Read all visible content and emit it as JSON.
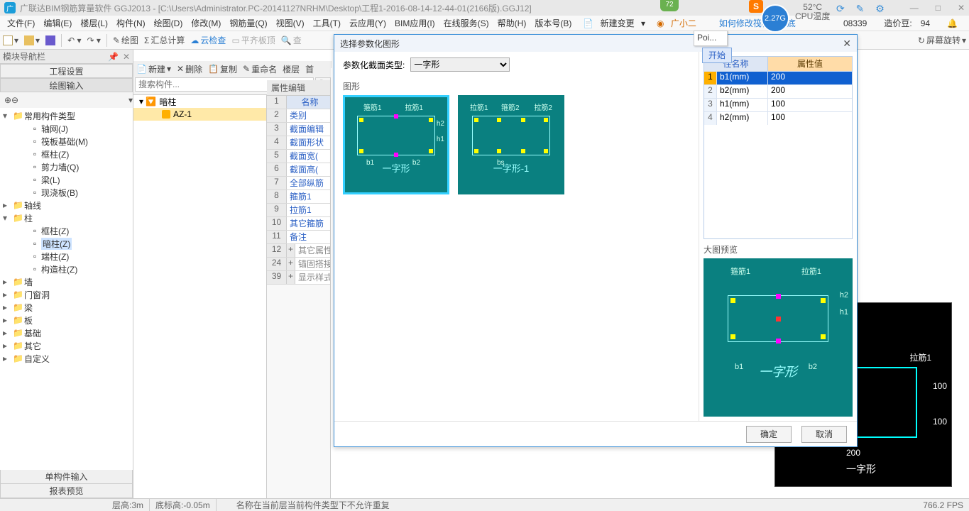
{
  "titlebar": {
    "app": "广联达BIM钢筋算量软件 GGJ2013 - [C:\\Users\\Administrator.PC-20141127NRHM\\Desktop\\工程1-2016-08-14-12-44-01(2166版).GGJ12]",
    "badge72": "72",
    "badgeS": "S",
    "circle": "2.27G",
    "temp_val": "52°C",
    "temp_lbl": "CPU温度",
    "win_min": "—",
    "win_max": "□",
    "win_close": "✕"
  },
  "menu": {
    "items": [
      "文件(F)",
      "编辑(E)",
      "楼层(L)",
      "构件(N)",
      "绘图(D)",
      "修改(M)",
      "钢筋量(Q)",
      "视图(V)",
      "工具(T)",
      "云应用(Y)",
      "BIM应用(I)",
      "在线服务(S)",
      "帮助(H)",
      "版本号(B)"
    ],
    "new_change": "新建变更",
    "user": "广小二",
    "link": "如何修改筏板基础底",
    "code": "08339",
    "bean_lbl": "造价豆:",
    "bean_val": "94"
  },
  "toolbar": {
    "draw": "绘图",
    "sum": "汇总计算",
    "cloud": "云检查",
    "flat": "平齐板顶",
    "find": "查",
    "rotate": "屏幕旋转"
  },
  "left": {
    "nav_title": "模块导航栏",
    "btn_proj": "工程设置",
    "btn_draw": "绘图输入",
    "tree": [
      {
        "t": "常用构件类型",
        "exp": true,
        "children": [
          {
            "t": "轴网(J)"
          },
          {
            "t": "筏板基础(M)"
          },
          {
            "t": "框柱(Z)"
          },
          {
            "t": "剪力墙(Q)"
          },
          {
            "t": "梁(L)"
          },
          {
            "t": "现浇板(B)"
          }
        ]
      },
      {
        "t": "轴线",
        "exp": false
      },
      {
        "t": "柱",
        "exp": true,
        "children": [
          {
            "t": "框柱(Z)"
          },
          {
            "t": "暗柱(Z)",
            "sel": true
          },
          {
            "t": "端柱(Z)"
          },
          {
            "t": "构造柱(Z)"
          }
        ]
      },
      {
        "t": "墙",
        "exp": false
      },
      {
        "t": "门窗洞",
        "exp": false
      },
      {
        "t": "梁",
        "exp": false
      },
      {
        "t": "板",
        "exp": false
      },
      {
        "t": "基础",
        "exp": false
      },
      {
        "t": "其它",
        "exp": false
      },
      {
        "t": "自定义",
        "exp": false
      }
    ],
    "btn_single": "单构件输入",
    "btn_report": "报表预览"
  },
  "toolbar2": {
    "new": "新建",
    "del": "删除",
    "copy": "复制",
    "rename": "重命名",
    "floor": "楼层",
    "first": "首"
  },
  "search_ph": "搜索构件...",
  "tree2": {
    "root": "暗柱",
    "child": "AZ-1"
  },
  "prop": {
    "title": "属性编辑",
    "rows": [
      {
        "n": "1",
        "name": "名称",
        "hdr": true
      },
      {
        "n": "2",
        "name": "类别"
      },
      {
        "n": "3",
        "name": "截面编辑"
      },
      {
        "n": "4",
        "name": "截面形状"
      },
      {
        "n": "5",
        "name": "截面宽("
      },
      {
        "n": "6",
        "name": "截面高("
      },
      {
        "n": "7",
        "name": "全部纵筋"
      },
      {
        "n": "8",
        "name": "箍筋1"
      },
      {
        "n": "9",
        "name": "拉筋1"
      },
      {
        "n": "10",
        "name": "其它箍筋"
      },
      {
        "n": "11",
        "name": "备注"
      },
      {
        "n": "12",
        "name": "其它属性",
        "exp": "+",
        "gray": true
      },
      {
        "n": "24",
        "name": "锚固搭接",
        "exp": "+",
        "gray": true
      },
      {
        "n": "39",
        "name": "显示样式",
        "exp": "+",
        "gray": true
      }
    ]
  },
  "dialog": {
    "title": "选择参数化图形",
    "param_type_lbl": "参数化截面类型:",
    "param_type_val": "一字形",
    "shapes_lbl": "图形",
    "shape1": "一字形",
    "shape2": "一字形-1",
    "s_gu1": "箍筋1",
    "s_la1": "拉筋1",
    "s_b1": "b1",
    "s_b2": "b2",
    "s_h1": "h1",
    "s_h2": "h2",
    "s2_g1": "拉筋1",
    "s2_g2": "箍筋2",
    "s2_g3": "拉筋2",
    "s2_bs": "bs",
    "poi": "Poi...",
    "start": "开始",
    "table": {
      "h1": "性名称",
      "h2": "属性值",
      "rows": [
        {
          "i": "1",
          "n": "b1(mm)",
          "v": "200",
          "sel": true
        },
        {
          "i": "2",
          "n": "b2(mm)",
          "v": "200"
        },
        {
          "i": "3",
          "n": "h1(mm)",
          "v": "100"
        },
        {
          "i": "4",
          "n": "h2(mm)",
          "v": "100"
        }
      ]
    },
    "preview_lbl": "大图预览",
    "pv_gu": "箍筋1",
    "pv_la": "拉筋1",
    "pv_b1": "b1",
    "pv_b2": "b2",
    "pv_h1": "h1",
    "pv_h2": "h2",
    "pv_cap": "一字形",
    "ok": "确定",
    "cancel": "取消"
  },
  "canvas": {
    "la": "拉筋1",
    "d100": "100",
    "d200": "200",
    "cap": "一字形"
  },
  "status": {
    "seg1": "层高:3m",
    "seg2": "底标高:-0.05m",
    "msg": "名称在当前层当前构件类型下不允许重复",
    "fps": "766.2 FPS"
  }
}
